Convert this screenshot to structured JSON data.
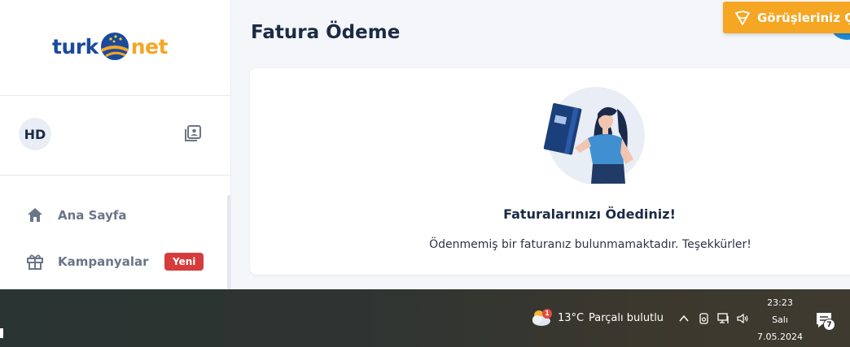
{
  "brand": {
    "logo_left": "turk",
    "logo_right": "net"
  },
  "user": {
    "initials": "HD"
  },
  "nav": [
    {
      "label": "Ana Sayfa",
      "icon": "home-icon"
    },
    {
      "label": "Kampanyalar",
      "icon": "gift-icon",
      "badge": "Yeni"
    }
  ],
  "page": {
    "title": "Fatura Ödeme"
  },
  "feedback": {
    "label": "Görüşleriniz Ço"
  },
  "card": {
    "title": "Faturalarınızı Ödediniz!",
    "text": "Ödenmemiş bir faturanız bulunmamaktadır. Teşekkürler!"
  },
  "taskbar": {
    "weather_badge": "1",
    "temperature": "13°C",
    "weather": "Parçalı bulutlu",
    "time": "23:23",
    "day": "Salı",
    "date": "7.05.2024",
    "notification_count": "7"
  },
  "colors": {
    "brand_blue": "#1b4a9c",
    "brand_orange": "#f5a623",
    "badge_red": "#d63c3c"
  }
}
